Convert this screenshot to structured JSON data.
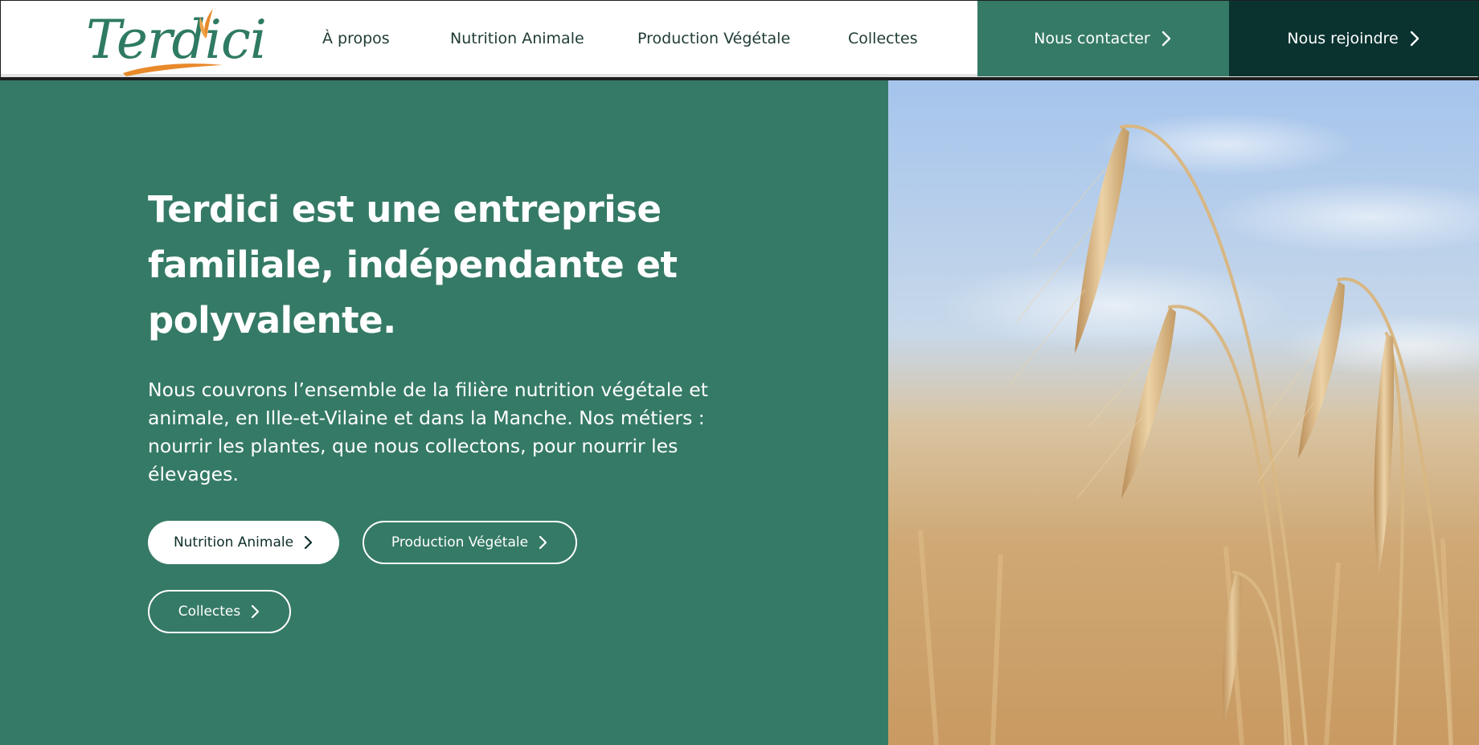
{
  "header": {
    "logo_text": "Terdici",
    "nav": [
      {
        "label": "À propos"
      },
      {
        "label": "Nutrition Animale"
      },
      {
        "label": "Production Végétale"
      },
      {
        "label": "Collectes"
      }
    ],
    "contact_label": "Nous contacter",
    "join_label": "Nous rejoindre"
  },
  "hero": {
    "title": "Terdici est une entreprise familiale, indépendante et polyvalente.",
    "text": "Nous couvrons l’ensemble de la filière nutrition végétale et animale, en Ille-et-Vilaine et dans la Manche. Nos métiers : nourrir les plantes, que nous collectons, pour nourrir les élevages.",
    "buttons": [
      {
        "label": "Nutrition Animale"
      },
      {
        "label": "Production Végétale"
      },
      {
        "label": "Collectes"
      }
    ],
    "image": "wheat-field-photo"
  },
  "colors": {
    "brand_green": "#357a66",
    "dark_teal": "#0a3330",
    "logo_orange": "#e8892a"
  },
  "icons": [
    "chevron-right-icon",
    "wheat-leaf-logo-icon"
  ]
}
